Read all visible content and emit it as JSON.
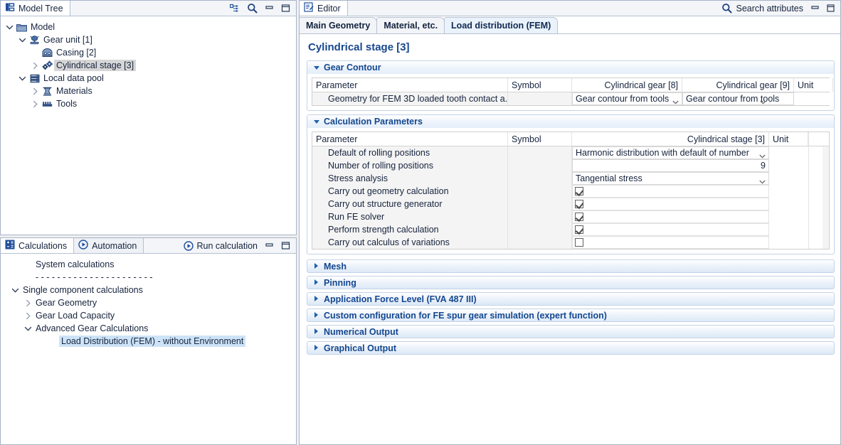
{
  "model_tree_view": {
    "tab_label": "Model Tree",
    "tools": [
      "link-with-editor-icon",
      "search-icon",
      "minimize-icon",
      "maximize-icon"
    ],
    "items": [
      {
        "label": "Model",
        "indent": 0,
        "twisty": "down",
        "icon": "folder-icon"
      },
      {
        "label": "Gear unit [1]",
        "indent": 1,
        "twisty": "down",
        "icon": "gear-unit-icon"
      },
      {
        "label": "Casing [2]",
        "indent": 2,
        "twisty": "none",
        "icon": "casing-icon"
      },
      {
        "label": "Cylindrical stage [3]",
        "indent": 2,
        "twisty": "right",
        "icon": "cylindrical-stage-icon",
        "selected": "grey"
      },
      {
        "label": "Local data pool",
        "indent": 1,
        "twisty": "down",
        "icon": "data-pool-icon"
      },
      {
        "label": "Materials",
        "indent": 2,
        "twisty": "right",
        "icon": "materials-icon"
      },
      {
        "label": "Tools",
        "indent": 2,
        "twisty": "right",
        "icon": "tools-icon"
      }
    ]
  },
  "calculations_view": {
    "tab_label": "Calculations",
    "tab2_label": "Automation",
    "run_label": "Run calculation",
    "tools": [
      "minimize-icon",
      "maximize-icon"
    ],
    "items": [
      {
        "label": "System calculations",
        "indent": 1,
        "twisty": "none"
      },
      {
        "label": "- - - - - - - - - - - - - - - - - - - - - -",
        "indent": 1,
        "twisty": "none",
        "dashed": true
      },
      {
        "label": "Single component calculations",
        "indent": 0,
        "twisty": "down"
      },
      {
        "label": "Gear Geometry",
        "indent": 1,
        "twisty": "right"
      },
      {
        "label": "Gear Load Capacity",
        "indent": 1,
        "twisty": "right"
      },
      {
        "label": "Advanced Gear Calculations",
        "indent": 1,
        "twisty": "down"
      },
      {
        "label": "Load Distribution (FEM) - without Environment",
        "indent": 3,
        "twisty": "none",
        "selected": "blue"
      }
    ]
  },
  "editor_view": {
    "tab_label": "Editor",
    "search_label": "Search attributes",
    "tools": [
      "search-icon",
      "minimize-icon",
      "maximize-icon"
    ],
    "tabs": [
      {
        "label": "Main Geometry",
        "active": false
      },
      {
        "label": "Material, etc.",
        "active": false
      },
      {
        "label": "Load distribution (FEM)",
        "active": true
      }
    ],
    "page_title": "Cylindrical stage [3]",
    "gear_contour": {
      "title": "Gear Contour",
      "expanded": true,
      "columns": [
        "Parameter",
        "Symbol",
        "Cylindrical gear [8]",
        "Cylindrical gear [9]",
        "Unit"
      ],
      "rows": [
        {
          "parameter": "Geometry for FEM 3D loaded tooth contact a...",
          "symbol": "",
          "gear8": "Gear contour from tools",
          "gear9": "Gear contour from tools",
          "unit": ""
        }
      ]
    },
    "calculation_parameters": {
      "title": "Calculation Parameters",
      "expanded": true,
      "columns": [
        "Parameter",
        "Symbol",
        "Cylindrical stage [3]",
        "Unit"
      ],
      "rows": [
        {
          "parameter": "Default of rolling positions",
          "symbol": "",
          "type": "combo",
          "value": "Harmonic distribution with default of number",
          "unit": ""
        },
        {
          "parameter": "Number of rolling positions",
          "symbol": "",
          "type": "number",
          "value": "9",
          "unit": ""
        },
        {
          "parameter": "Stress analysis",
          "symbol": "",
          "type": "combo",
          "value": "Tangential stress",
          "unit": ""
        },
        {
          "parameter": "Carry out geometry calculation",
          "symbol": "",
          "type": "checkbox",
          "value": true,
          "unit": ""
        },
        {
          "parameter": "Carry out structure generator",
          "symbol": "",
          "type": "checkbox",
          "value": true,
          "unit": ""
        },
        {
          "parameter": "Run FE solver",
          "symbol": "",
          "type": "checkbox",
          "value": true,
          "unit": ""
        },
        {
          "parameter": "Perform strength calculation",
          "symbol": "",
          "type": "checkbox",
          "value": true,
          "unit": ""
        },
        {
          "parameter": "Carry out calculus of variations",
          "symbol": "",
          "type": "checkbox",
          "value": false,
          "unit": ""
        }
      ]
    },
    "collapsed_sections": [
      {
        "title": "Mesh"
      },
      {
        "title": "Pinning"
      },
      {
        "title": "Application Force Level (FVA 487 III)"
      },
      {
        "title": "Custom configuration for FE spur gear simulation (expert function)"
      },
      {
        "title": "Numerical Output"
      },
      {
        "title": "Graphical Output"
      }
    ]
  },
  "colors": {
    "accent_blue": "#17478f",
    "section_header_text": "#14478f",
    "selection_grey": "#d6d6d6",
    "selection_blue": "#cde3f7",
    "panel_border": "#a7b4c6"
  }
}
